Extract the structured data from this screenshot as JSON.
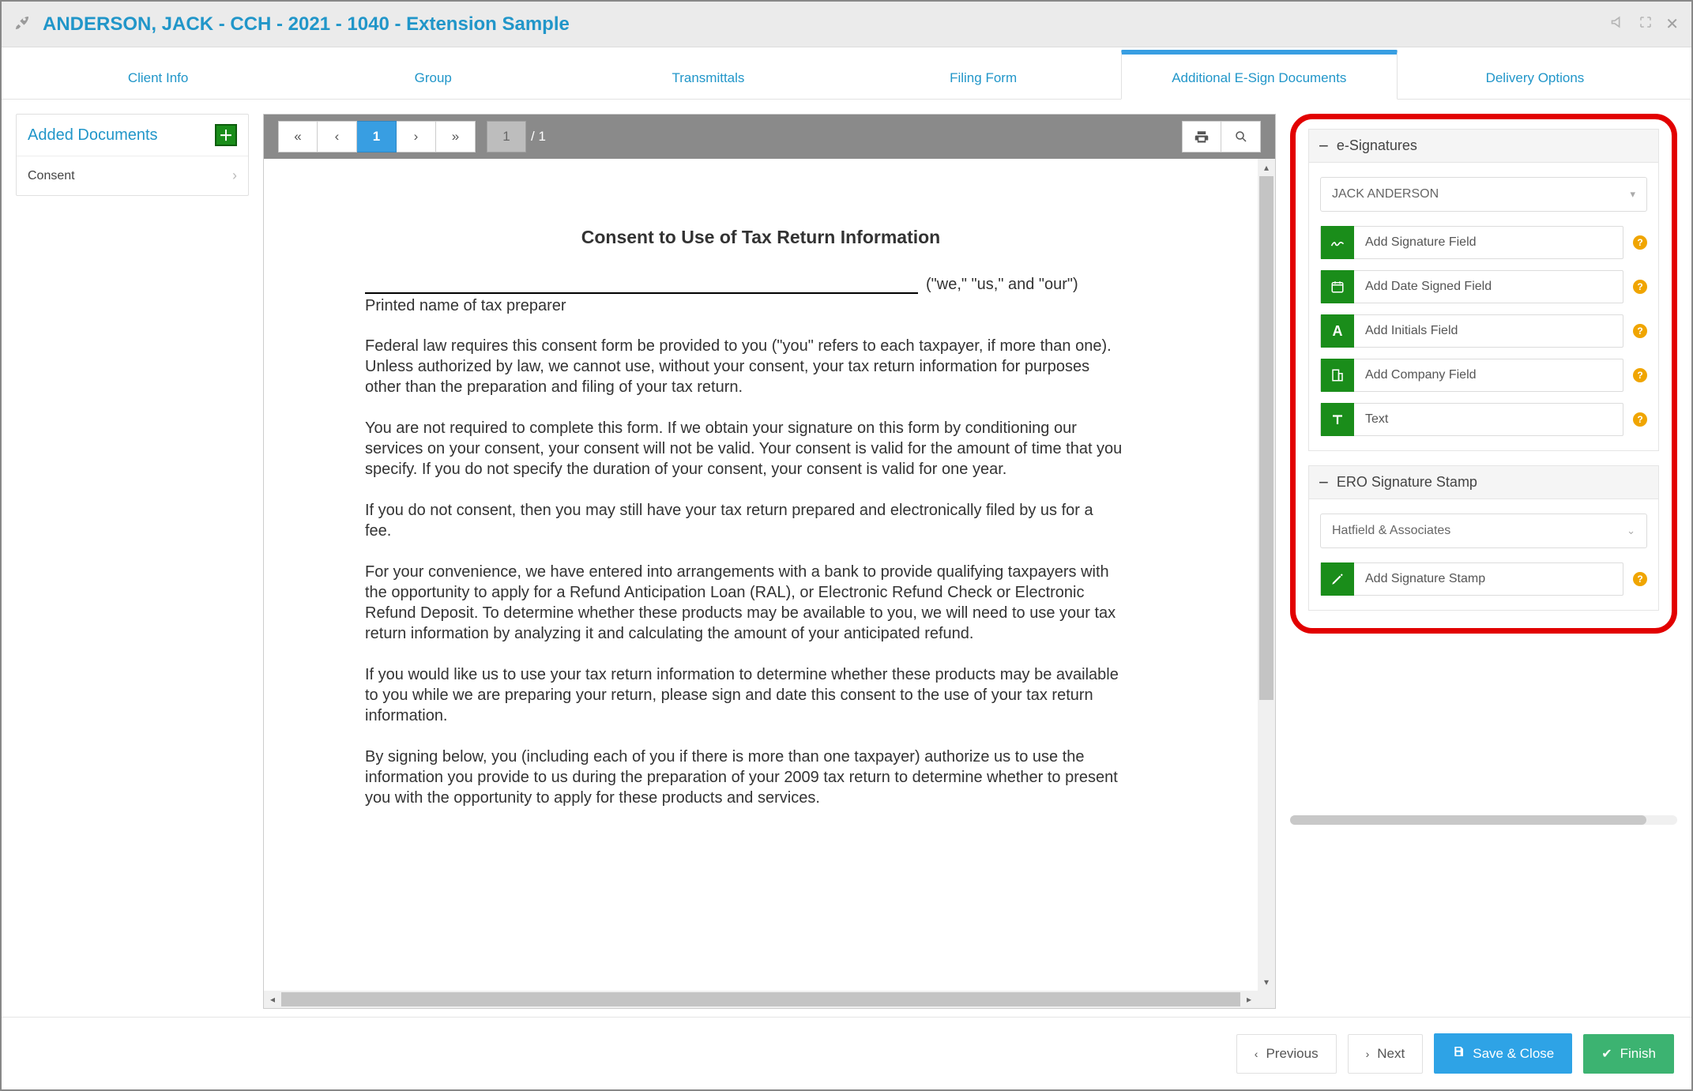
{
  "topbar": {
    "title": "ANDERSON, JACK - CCH - 2021 - 1040 - Extension Sample"
  },
  "tabs": {
    "items": [
      {
        "label": "Client Info"
      },
      {
        "label": "Group"
      },
      {
        "label": "Transmittals"
      },
      {
        "label": "Filing Form"
      },
      {
        "label": "Additional E-Sign Documents"
      },
      {
        "label": "Delivery Options"
      }
    ],
    "activeIndex": 4
  },
  "leftPanel": {
    "title": "Added Documents",
    "items": [
      {
        "label": "Consent"
      }
    ]
  },
  "viewer": {
    "currentPage": "1",
    "inputPage": "1",
    "pageInfo": "/ 1"
  },
  "document": {
    "title": "Consent to Use of Tax Return Information",
    "suffix": "(\"we,\" \"us,\" and \"our\")",
    "preparerLabel": "Printed name of tax preparer",
    "p1": "Federal law requires this consent form be provided to you (\"you\" refers to each taxpayer, if more than one). Unless authorized by law, we cannot use, without your consent, your tax return information for purposes other than the preparation and filing of your tax return.",
    "p2": "You are not required to complete this form. If we obtain your signature on this form by conditioning our services on your consent, your consent will not be valid. Your consent is valid for the amount of time that you specify. If you do not specify the duration of your consent, your consent is valid for one year.",
    "p3": "If you do not consent, then you may still have your tax return prepared and electronically filed by us for a fee.",
    "p4": "For your convenience, we have entered into arrangements with a bank to provide qualifying taxpayers with the opportunity to apply for a Refund Anticipation Loan (RAL), or Electronic Refund Check or Electronic Refund Deposit. To determine whether these products may be available to you, we will need to use your tax return information by analyzing it and calculating the amount of your anticipated refund.",
    "p5": "If you would like us to use your tax return information to determine whether these products may be available to you while we are preparing your return, please sign and date this consent to the use of your tax return information.",
    "p6": "By signing below, you (including each of you if there is more than one taxpayer) authorize us to use the information you provide to us during the preparation of your 2009 tax return to determine whether to present you with the opportunity to apply for these products and services."
  },
  "rightPanel": {
    "esig": {
      "header": "e-Signatures",
      "signer": "JACK ANDERSON",
      "actions": [
        {
          "label": "Add Signature Field",
          "icon": "signature"
        },
        {
          "label": "Add Date Signed Field",
          "icon": "calendar"
        },
        {
          "label": "Add Initials Field",
          "icon": "initials"
        },
        {
          "label": "Add Company Field",
          "icon": "company"
        },
        {
          "label": "Text",
          "icon": "text"
        }
      ]
    },
    "ero": {
      "header": "ERO Signature Stamp",
      "company": "Hatfield & Associates",
      "actions": [
        {
          "label": "Add Signature Stamp",
          "icon": "pencil"
        }
      ]
    }
  },
  "footer": {
    "prev": "Previous",
    "next": "Next",
    "save": "Save & Close",
    "finish": "Finish"
  },
  "colors": {
    "accent": "#389ee2",
    "green": "#1a8d1a",
    "highlight": "#e20000"
  }
}
